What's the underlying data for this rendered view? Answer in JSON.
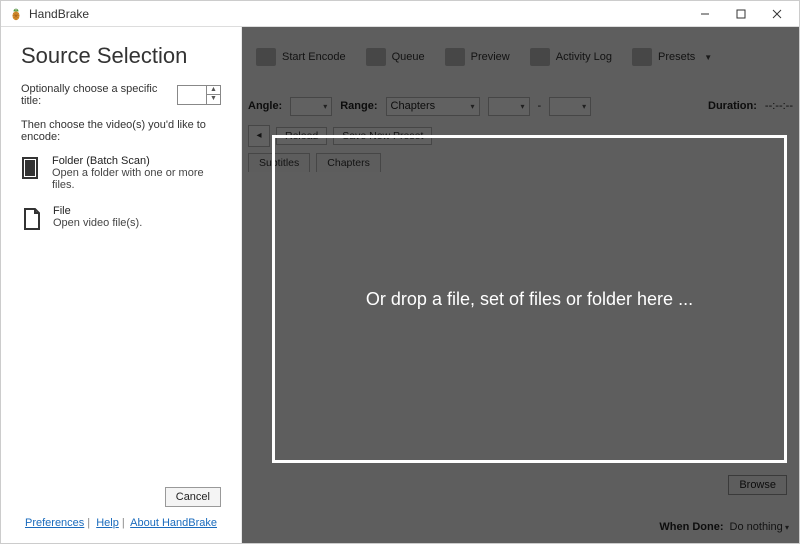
{
  "window": {
    "title": "HandBrake"
  },
  "sidebar": {
    "heading": "Source Selection",
    "title_label": "Optionally choose a specific title:",
    "title_value": "",
    "instruction": "Then choose the video(s) you'd like to encode:",
    "sources": {
      "folder": {
        "title": "Folder (Batch Scan)",
        "desc": "Open a folder with one or more files."
      },
      "file": {
        "title": "File",
        "desc": "Open video file(s)."
      }
    },
    "cancel_label": "Cancel",
    "links": {
      "preferences": "Preferences",
      "help": "Help",
      "about": "About HandBrake"
    }
  },
  "toolbar": {
    "start_encode": "Start Encode",
    "queue": "Queue",
    "preview": "Preview",
    "activity": "Activity Log",
    "presets": "Presets"
  },
  "range": {
    "angle_label": "Angle:",
    "range_label": "Range:",
    "range_type": "Chapters",
    "from": "",
    "to_sep": "-",
    "to": "",
    "duration_label": "Duration:",
    "duration_value": "--:--:--"
  },
  "prerow": {
    "reload": "Reload",
    "save_preset": "Save New Preset"
  },
  "tabs": {
    "subtitles": "Subtitles",
    "chapters": "Chapters"
  },
  "dropzone": {
    "text": "Or drop a file, set of files or folder here ..."
  },
  "browse_label": "Browse",
  "when_done": {
    "label": "When Done:",
    "value": "Do nothing"
  }
}
